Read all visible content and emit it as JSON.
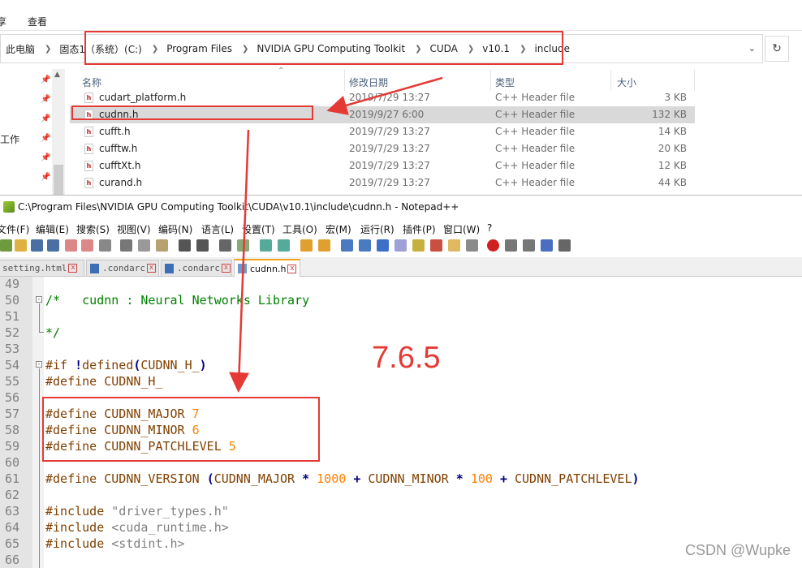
{
  "explorer": {
    "ribbon_tabs": [
      "享",
      "查看"
    ],
    "address_segments": [
      "此电脑",
      "固态1（系统）(C:)",
      "Program Files",
      "NVIDIA GPU Computing Toolkit",
      "CUDA",
      "v10.1",
      "include"
    ],
    "nav_label": "工作",
    "columns": {
      "name": "名称",
      "date": "修改日期",
      "type": "类型",
      "size": "大小"
    },
    "files": [
      {
        "name": "cudart_platform.h",
        "date": "2019/7/29 13:27",
        "type": "C++ Header file",
        "size": "3 KB",
        "selected": false
      },
      {
        "name": "cudnn.h",
        "date": "2019/9/27 6:00",
        "type": "C++ Header file",
        "size": "132 KB",
        "selected": true
      },
      {
        "name": "cufft.h",
        "date": "2019/7/29 13:27",
        "type": "C++ Header file",
        "size": "14 KB",
        "selected": false
      },
      {
        "name": "cufftw.h",
        "date": "2019/7/29 13:27",
        "type": "C++ Header file",
        "size": "20 KB",
        "selected": false
      },
      {
        "name": "cufftXt.h",
        "date": "2019/7/29 13:27",
        "type": "C++ Header file",
        "size": "12 KB",
        "selected": false
      },
      {
        "name": "curand.h",
        "date": "2019/7/29 13:27",
        "type": "C++ Header file",
        "size": "44 KB",
        "selected": false
      }
    ]
  },
  "notepad": {
    "title": "C:\\Program Files\\NVIDIA GPU Computing Toolkit\\CUDA\\v10.1\\include\\cudnn.h - Notepad++",
    "menu": [
      "文件(F)",
      "编辑(E)",
      "搜索(S)",
      "视图(V)",
      "编码(N)",
      "语言(L)",
      "设置(T)",
      "工具(O)",
      "宏(M)",
      "运行(R)",
      "插件(P)",
      "窗口(W)",
      "?"
    ],
    "tabs": [
      {
        "label": "setting.html",
        "active": false
      },
      {
        "label": ".condarc",
        "active": false
      },
      {
        "label": ".condarc",
        "active": false
      },
      {
        "label": "cudnn.h",
        "active": true
      }
    ],
    "lines": [
      {
        "n": "49",
        "text": ""
      },
      {
        "n": "50",
        "text": "/*   cudnn : Neural Networks Library"
      },
      {
        "n": "51",
        "text": ""
      },
      {
        "n": "52",
        "text": "*/"
      },
      {
        "n": "53",
        "text": ""
      },
      {
        "n": "54",
        "text": "#if !defined(CUDNN_H_)"
      },
      {
        "n": "55",
        "text": "#define CUDNN_H_"
      },
      {
        "n": "56",
        "text": ""
      },
      {
        "n": "57",
        "text": "#define CUDNN_MAJOR 7"
      },
      {
        "n": "58",
        "text": "#define CUDNN_MINOR 6"
      },
      {
        "n": "59",
        "text": "#define CUDNN_PATCHLEVEL 5"
      },
      {
        "n": "60",
        "text": ""
      },
      {
        "n": "61",
        "text": "#define CUDNN_VERSION (CUDNN_MAJOR * 1000 + CUDNN_MINOR * 100 + CUDNN_PATCHLEVEL)"
      },
      {
        "n": "62",
        "text": ""
      },
      {
        "n": "63",
        "text": "#include \"driver_types.h\""
      },
      {
        "n": "64",
        "text": "#include <cuda_runtime.h>"
      },
      {
        "n": "65",
        "text": "#include <stdint.h>"
      },
      {
        "n": "66",
        "text": ""
      }
    ]
  },
  "annotation": {
    "version_text": "7.6.5",
    "color": "#e53935"
  },
  "watermark": "CSDN @Wupke"
}
